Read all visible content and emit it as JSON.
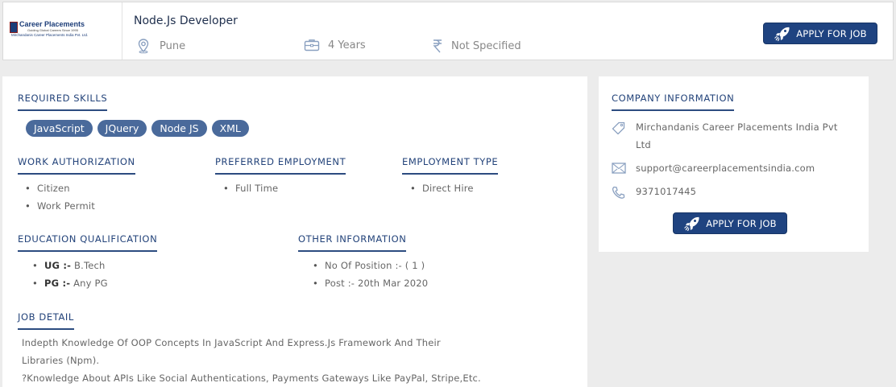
{
  "header": {
    "logo": {
      "name": "Career Placements",
      "tagline": "Guiding Global Careers Since 1995",
      "company_line": "Mirchandanis Career Placements India Pvt. Ltd."
    },
    "job_title": "Node.Js Developer",
    "location": "Pune",
    "experience": "4 Years",
    "salary": "Not Specified",
    "apply_label": "APPLY FOR JOB"
  },
  "required_skills": {
    "heading": "REQUIRED SKILLS",
    "skills": [
      "JavaScript",
      "JQuery",
      "Node JS",
      "XML"
    ]
  },
  "work_authorization": {
    "heading": "WORK AUTHORIZATION",
    "items": [
      "Citizen",
      "Work Permit"
    ]
  },
  "preferred_employment": {
    "heading": "PREFERRED EMPLOYMENT",
    "items": [
      "Full Time"
    ]
  },
  "employment_type": {
    "heading": "EMPLOYMENT TYPE",
    "items": [
      "Direct Hire"
    ]
  },
  "education": {
    "heading": "EDUCATION QUALIFICATION",
    "items": [
      {
        "label": "UG :-",
        "value": "B.Tech"
      },
      {
        "label": "PG :-",
        "value": "Any PG"
      }
    ]
  },
  "other_information": {
    "heading": "OTHER INFORMATION",
    "items": [
      "No Of Position :- ( 1 )",
      "Post :- 20th Mar 2020"
    ]
  },
  "job_detail": {
    "heading": "JOB DETAIL",
    "lines": [
      "Indepth Knowledge Of OOP Concepts In JavaScript And Express.Js Framework And Their",
      "Libraries (Npm).",
      "?Knowledge About APIs Like Social Authentications, Payments Gateways Like PayPal, Stripe,Etc."
    ]
  },
  "company_information": {
    "heading": "COMPANY INFORMATION",
    "name_lines": [
      "Mirchandanis Career Placements India Pvt",
      "Ltd"
    ],
    "email": "support@careerplacementsindia.com",
    "phone": "9371017445",
    "apply_label": "APPLY FOR JOB"
  },
  "colors": {
    "accent": "#1f4380",
    "skill_pill": "#4a6a9b",
    "heading": "#23437a"
  },
  "icons": [
    "location-pin-icon",
    "briefcase-icon",
    "rupee-icon",
    "rocket-icon",
    "tag-icon",
    "mail-icon",
    "phone-icon"
  ]
}
